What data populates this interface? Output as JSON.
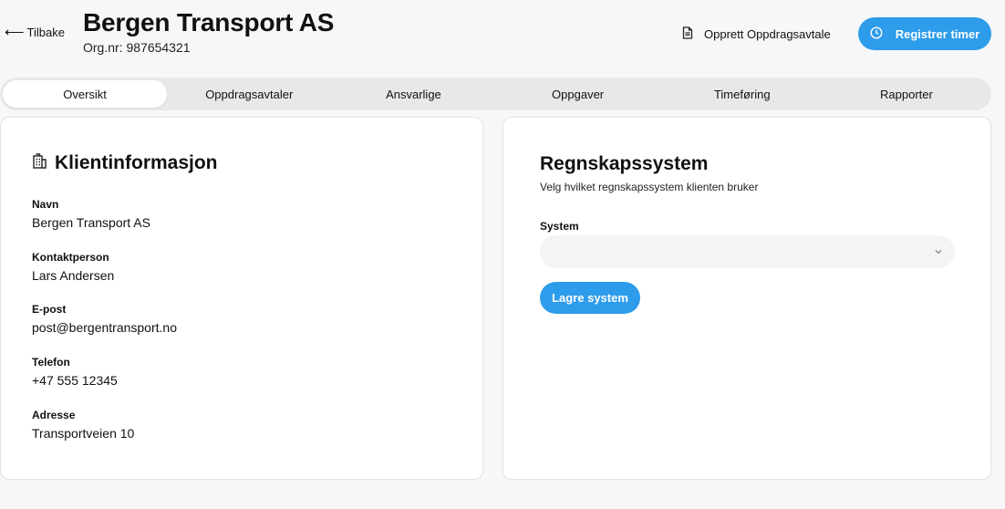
{
  "header": {
    "back_label": "Tilbake",
    "back_icon": "arrow-left-icon",
    "title": "Bergen Transport AS",
    "orgnr": "Org.nr: 987654321",
    "create_agreement_label": "Opprett Oppdragsavtale",
    "create_agreement_icon": "document-icon",
    "register_hours_label": "Registrer timer",
    "register_hours_icon": "clock-icon"
  },
  "tabs": [
    {
      "label": "Oversikt",
      "active": true
    },
    {
      "label": "Oppdragsavtaler",
      "active": false
    },
    {
      "label": "Ansvarlige",
      "active": false
    },
    {
      "label": "Oppgaver",
      "active": false
    },
    {
      "label": "Timeføring",
      "active": false
    },
    {
      "label": "Rapporter",
      "active": false
    }
  ],
  "client_info": {
    "title": "Klientinformasjon",
    "icon": "building-icon",
    "fields": [
      {
        "label": "Navn",
        "value": "Bergen Transport AS"
      },
      {
        "label": "Kontaktperson",
        "value": "Lars Andersen"
      },
      {
        "label": "E-post",
        "value": "post@bergentransport.no"
      },
      {
        "label": "Telefon",
        "value": "+47 555 12345"
      },
      {
        "label": "Adresse",
        "value": "Transportveien 10"
      }
    ]
  },
  "accounting": {
    "title": "Regnskapssystem",
    "subtitle": "Velg hvilket regnskapssystem klienten bruker",
    "system_label": "System",
    "system_value": "",
    "save_label": "Lagre system"
  },
  "colors": {
    "accent": "#2d9cea",
    "background": "#f7f7f9",
    "tab_bar": "#e8e8ea"
  }
}
